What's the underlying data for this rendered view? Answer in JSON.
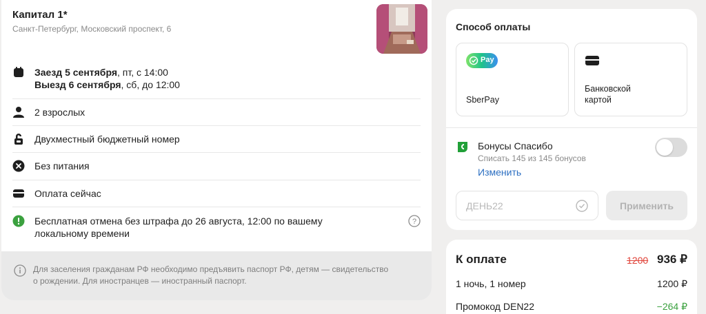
{
  "hotel": {
    "name": "Капитал 1*",
    "address": "Санкт-Петербург, Московский проспект, 6"
  },
  "details": {
    "checkin_bold": "Заезд 5 сентября",
    "checkin_rest": ", пт, с 14:00",
    "checkout_bold": "Выезд 6 сентября",
    "checkout_rest": ", сб, до 12:00",
    "guests": "2 взрослых",
    "room": "Двухместный бюджетный номер",
    "meals": "Без питания",
    "payment": "Оплата сейчас",
    "cancellation_line1": "Бесплатная отмена без штрафа до 26 августа, 12:00 по вашему",
    "cancellation_line2": "локальному времени"
  },
  "notice": {
    "line1": "Для заселения гражданам РФ необходимо предъявить паспорт РФ, детям — свидетельство",
    "line2": "о рождении. Для иностранцев — иностранный паспорт."
  },
  "payment_method": {
    "title": "Способ оплаты",
    "sberpay_badge": "Pay",
    "sberpay_label": "SberPay",
    "card_label_line1": "Банковской",
    "card_label_line2": "картой"
  },
  "bonus": {
    "title": "Бонусы Спасибо",
    "subtitle": "Списать 145 из 145 бонусов",
    "change_link": "Изменить",
    "enabled": false
  },
  "promo": {
    "value": "ДЕНЬ22",
    "apply_label": "Применить"
  },
  "total": {
    "title": "К оплате",
    "old_price": "1200",
    "new_price": "936 ₽",
    "lines": [
      {
        "label": "1 ночь, 1 номер",
        "value": "1200 ₽"
      },
      {
        "label": "Промокод DEN22",
        "value": "−264 ₽"
      }
    ]
  },
  "colors": {
    "accent_green": "#3ba13f",
    "link_blue": "#2c6fc2",
    "discount_red": "#e0443a"
  }
}
